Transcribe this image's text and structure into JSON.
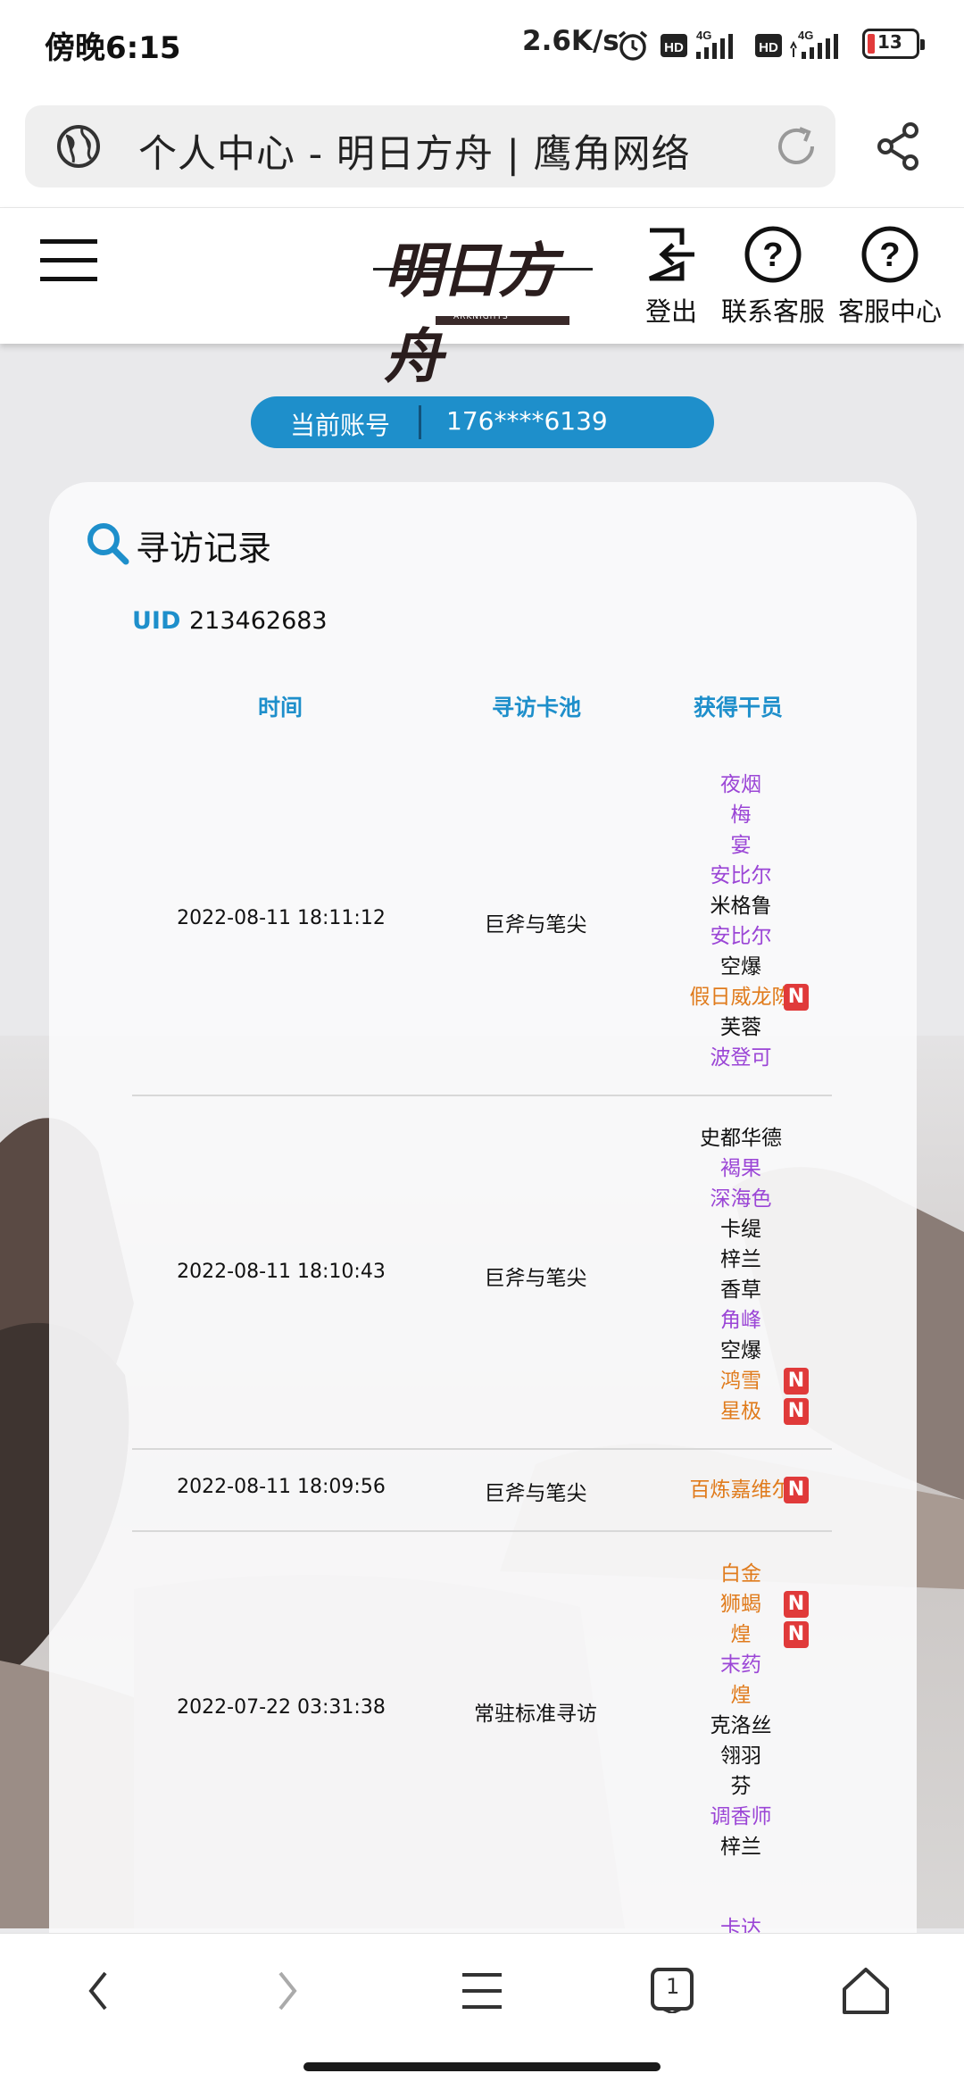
{
  "status_bar": {
    "time": "傍晚6:15",
    "net_speed": "2.6K/s",
    "battery": "13"
  },
  "browser": {
    "url_title": "个人中心 - 明日方舟 | 鹰角网络"
  },
  "header": {
    "logo_text": "明日方舟",
    "logo_subtext": "ARKNIGHTS",
    "logout_label": "登出",
    "contact_label": "联系客服",
    "service_center_label": "客服中心"
  },
  "account": {
    "label": "当前账号",
    "value": "176****6139"
  },
  "records": {
    "title": "寻访记录",
    "uid_label": "UID",
    "uid_value": "213462683",
    "columns": [
      "时间",
      "寻访卡池",
      "获得干员"
    ],
    "rows": [
      {
        "time": "2022-08-11 18:11:12",
        "pool": "巨斧与笔尖",
        "operators": [
          {
            "name": "夜烟",
            "rarity": 4
          },
          {
            "name": "梅",
            "rarity": 4
          },
          {
            "name": "宴",
            "rarity": 4
          },
          {
            "name": "安比尔",
            "rarity": 4
          },
          {
            "name": "米格鲁",
            "rarity": 3
          },
          {
            "name": "安比尔",
            "rarity": 4
          },
          {
            "name": "空爆",
            "rarity": 3
          },
          {
            "name": "假日威龙陈",
            "rarity": 6,
            "new": true
          },
          {
            "name": "芙蓉",
            "rarity": 3
          },
          {
            "name": "波登可",
            "rarity": 4
          }
        ]
      },
      {
        "time": "2022-08-11 18:10:43",
        "pool": "巨斧与笔尖",
        "operators": [
          {
            "name": "史都华德",
            "rarity": 3
          },
          {
            "name": "褐果",
            "rarity": 4
          },
          {
            "name": "深海色",
            "rarity": 4
          },
          {
            "name": "卡缇",
            "rarity": 3
          },
          {
            "name": "梓兰",
            "rarity": 3
          },
          {
            "name": "香草",
            "rarity": 3
          },
          {
            "name": "角峰",
            "rarity": 4
          },
          {
            "name": "空爆",
            "rarity": 3
          },
          {
            "name": "鸿雪",
            "rarity": 5,
            "new": true
          },
          {
            "name": "星极",
            "rarity": 5,
            "new": true
          }
        ]
      },
      {
        "time": "2022-08-11 18:09:56",
        "pool": "巨斧与笔尖",
        "operators": [
          {
            "name": "百炼嘉维尔",
            "rarity": 6,
            "new": true
          }
        ]
      },
      {
        "time": "2022-07-22 03:31:38",
        "pool": "常驻标准寻访",
        "operators": [
          {
            "name": "白金",
            "rarity": 5
          },
          {
            "name": "狮蝎",
            "rarity": 5,
            "new": true
          },
          {
            "name": "煌",
            "rarity": 6,
            "new": true
          },
          {
            "name": "末药",
            "rarity": 4
          },
          {
            "name": "煌",
            "rarity": 6
          },
          {
            "name": "克洛丝",
            "rarity": 3
          },
          {
            "name": "翎羽",
            "rarity": 3
          },
          {
            "name": "芬",
            "rarity": 3
          },
          {
            "name": "调香师",
            "rarity": 4
          },
          {
            "name": "梓兰",
            "rarity": 3
          }
        ]
      }
    ],
    "partial_next_operator": "卡达"
  },
  "colors": {
    "accent_blue": "#1e8fcb",
    "rarity_4_purple": "#9b46d6",
    "rarity_5_6_orange": "#e07b1c",
    "rarity_3_black": "#111111",
    "new_badge_red": "#e03a3a"
  },
  "new_badge_text": "N",
  "bottom_nav": {
    "tab_count": "1"
  }
}
